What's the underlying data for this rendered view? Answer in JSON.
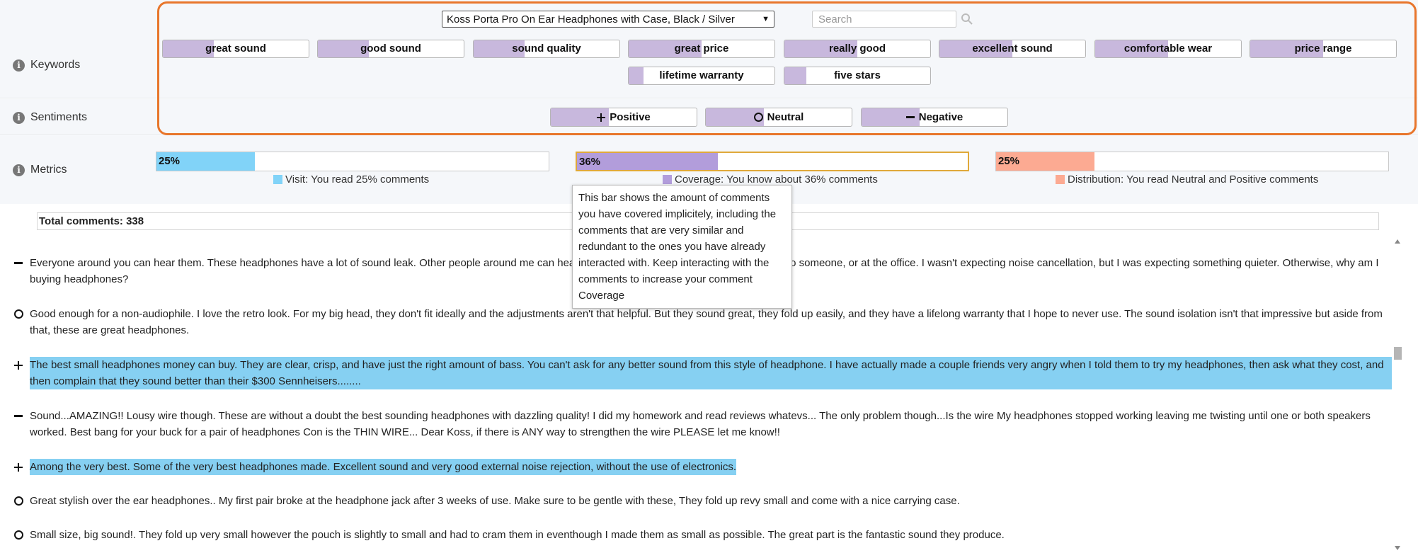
{
  "header": {
    "product_selected": "Koss Porta Pro On Ear Headphones with Case, Black / Silver",
    "search_placeholder": "Search"
  },
  "rows": {
    "keywords_label": "Keywords",
    "sentiments_label": "Sentiments",
    "metrics_label": "Metrics"
  },
  "keywords": [
    {
      "label": "great sound",
      "progress": 0.35
    },
    {
      "label": "good sound",
      "progress": 0.35
    },
    {
      "label": "sound quality",
      "progress": 0.35
    },
    {
      "label": "great price",
      "progress": 0.5
    },
    {
      "label": "really good",
      "progress": 0.5
    },
    {
      "label": "excellent sound",
      "progress": 0.5
    },
    {
      "label": "comfortable wear",
      "progress": 0.5
    },
    {
      "label": "price range",
      "progress": 0.5
    },
    {
      "label": "lifetime warranty",
      "progress": 0.1
    },
    {
      "label": "five stars",
      "progress": 0.15
    }
  ],
  "sentiments": [
    {
      "label": "Positive",
      "icon": "plus-icon"
    },
    {
      "label": "Neutral",
      "icon": "circle-icon"
    },
    {
      "label": "Negative",
      "icon": "minus-icon"
    }
  ],
  "metrics": [
    {
      "pct": "25%",
      "value": 25,
      "color": "#81d3f8",
      "legend": "Visit: You read 25% comments"
    },
    {
      "pct": "36%",
      "value": 36,
      "color": "#b29ddb",
      "legend": "Coverage: You know about 36% comments"
    },
    {
      "pct": "25%",
      "value": 25,
      "color": "#fcaa92",
      "legend": "Distribution: You read Neutral and Positive comments"
    }
  ],
  "tooltip": {
    "text": "This bar shows the amount of comments you have covered implicitely, including the comments that are very similar and redundant to the ones you have already interacted with. Keep interacting with the comments to increase your comment Coverage"
  },
  "total_label": "Total comments: 338",
  "comments": [
    {
      "sentiment": "negative",
      "highlighted": false,
      "text": "Everyone around you can hear them. These headphones have a lot of sound leak. Other people around me can hear them whether I'm in bed, on the couch next to someone, or at the office. I wasn't expecting noise cancellation, but I was expecting something quieter. Otherwise, why am I buying headphones?"
    },
    {
      "sentiment": "neutral",
      "highlighted": false,
      "text": "Good enough for a non-audiophile. I love the retro look. For my big head, they don't fit ideally and the adjustments aren't that helpful. But they sound great, they fold up easily, and they have a lifelong warranty that I hope to never use. The sound isolation isn't that impressive but aside from that, these are great headphones."
    },
    {
      "sentiment": "positive",
      "highlighted": true,
      "text": "The best small headphones money can buy. They are clear, crisp, and have just the right amount of bass. You can't ask for any better sound from this style of headphone. I have actually made a couple friends very angry when I told them to try my headphones, then ask what they cost, and then complain that they sound better than their $300 Sennheisers........"
    },
    {
      "sentiment": "negative",
      "highlighted": false,
      "text": "Sound...AMAZING!! Lousy wire though. These are without a doubt the best sounding headphones with dazzling quality! I did my homework and read reviews whatevs... The only problem though...Is the wire My headphones stopped working leaving me twisting until one or both speakers worked. Best bang for your buck for a pair of headphones Con is the THIN WIRE... Dear Koss, if there is ANY way to strengthen the wire PLEASE let me know!!"
    },
    {
      "sentiment": "positive",
      "highlighted": true,
      "text": "Among the very best. Some of the very best headphones made. Excellent sound and very good external noise rejection, without the use of electronics."
    },
    {
      "sentiment": "neutral",
      "highlighted": false,
      "text": "Great stylish over the ear headphones.. My first pair broke at the headphone jack after 3 weeks of use. Make sure to be gentle with these, They fold up revy small and come with a nice carrying case."
    },
    {
      "sentiment": "neutral",
      "highlighted": false,
      "text": "Small size, big sound!. They fold up very small however the pouch is slightly to small and had to cram them in eventhough I made them as small as possible. The great part is the fantastic sound they produce."
    }
  ]
}
